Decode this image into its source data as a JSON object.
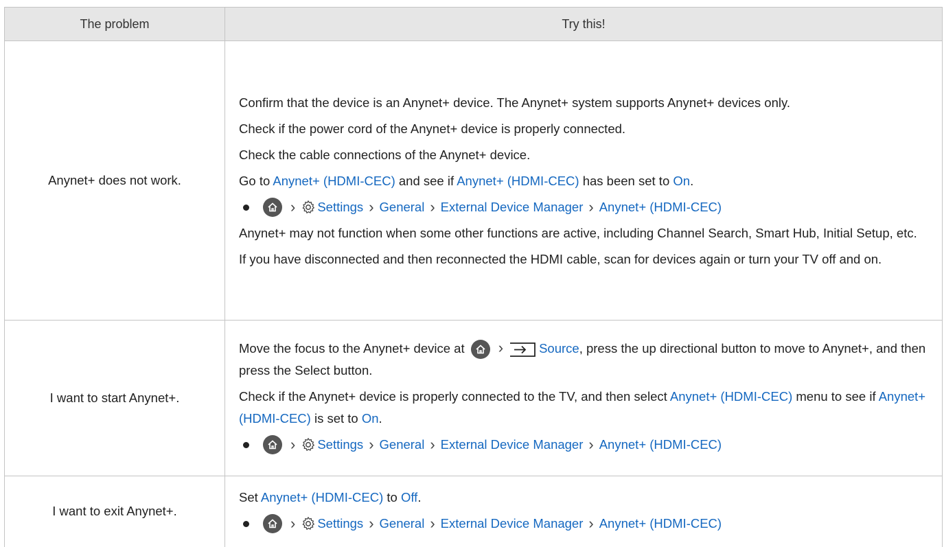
{
  "header": {
    "problem": "The problem",
    "try": "Try this!"
  },
  "path": {
    "settings": "Settings",
    "general": "General",
    "manager": "External Device Manager",
    "anynet": "Anynet+ (HDMI-CEC)",
    "source": "Source"
  },
  "rows": [
    {
      "problem": "Anynet+ does not work.",
      "p1": "Confirm that the device is an Anynet+ device. The Anynet+ system supports Anynet+ devices only.",
      "p2": "Check if the power cord of the Anynet+ device is properly connected.",
      "p3": "Check the cable connections of the Anynet+ device.",
      "p4_a": "Go to ",
      "p4_b": "Anynet+ (HDMI-CEC)",
      "p4_c": " and see if ",
      "p4_d": "Anynet+ (HDMI-CEC)",
      "p4_e": " has been set to ",
      "p4_f": "On",
      "p4_g": ".",
      "p5": "Anynet+ may not function when some other functions are active, including Channel Search, Smart Hub, Initial Setup, etc.",
      "p6": "If you have disconnected and then reconnected the HDMI cable, scan for devices again or turn your TV off and on."
    },
    {
      "problem": "I want to start Anynet+.",
      "p1_a": "Move the focus to the Anynet+ device at ",
      "p1_b": ", press the up directional button to move to Anynet+, and then press the Select button.",
      "p2_a": "Check if the Anynet+ device is properly connected to the TV, and then select ",
      "p2_b": "Anynet+ (HDMI-CEC)",
      "p2_c": " menu to see if ",
      "p2_d": "Anynet+ (HDMI-CEC)",
      "p2_e": " is set to ",
      "p2_f": "On",
      "p2_g": "."
    },
    {
      "problem": "I want to exit Anynet+.",
      "p1_a": "Set ",
      "p1_b": "Anynet+ (HDMI-CEC)",
      "p1_c": " to ",
      "p1_d": "Off",
      "p1_e": "."
    }
  ],
  "colors": {
    "link": "#1568c0",
    "header_bg": "#e6e6e6",
    "border": "#c4c4c4",
    "icon": "#555555"
  },
  "icons": [
    "home-icon",
    "gear-icon",
    "chevron-right-icon",
    "source-icon",
    "bullet-icon"
  ]
}
